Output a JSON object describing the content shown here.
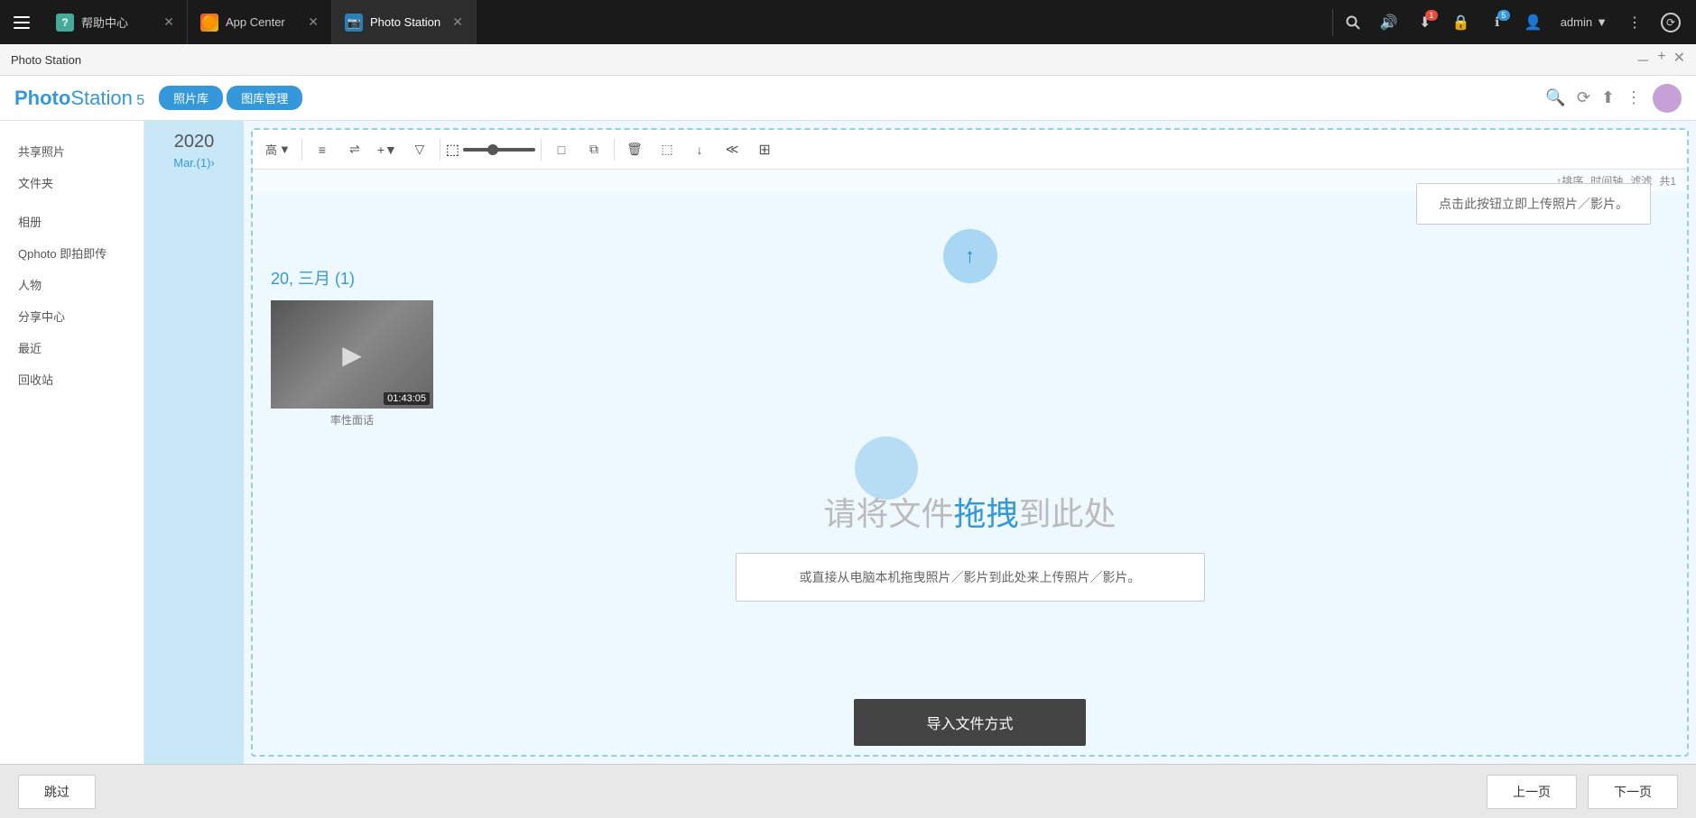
{
  "taskbar": {
    "tabs": [
      {
        "id": "help",
        "label": "帮助中心",
        "icon_type": "help",
        "icon_text": "?",
        "active": false
      },
      {
        "id": "appcenter",
        "label": "App Center",
        "icon_type": "appcenter",
        "icon_text": "✦",
        "active": false
      },
      {
        "id": "photostation",
        "label": "Photo Station",
        "icon_type": "photostation",
        "icon_text": "📷",
        "active": true
      }
    ],
    "notifications": {
      "download_badge": "1",
      "info_badge": "5"
    },
    "user": "admin",
    "dropdown_arrow": "▼"
  },
  "window": {
    "title": "Photo Station",
    "controls": {
      "minimize": "－",
      "maximize": "+",
      "close": "✕"
    }
  },
  "app_header": {
    "logo_photo": "Photo",
    "logo_station": "Station",
    "logo_version": " 5",
    "nav_photos": "照片库",
    "nav_library": "图库管理"
  },
  "sidebar": {
    "items": [
      {
        "label": "共享照片"
      },
      {
        "label": "文件夹"
      },
      {
        "label": "相册"
      },
      {
        "label": "Qphoto 即拍即传"
      },
      {
        "label": "人物"
      },
      {
        "label": "分享中心"
      },
      {
        "label": "最近"
      },
      {
        "label": "回收站"
      }
    ]
  },
  "timeline": {
    "year": "2020",
    "month": "Mar.(1)",
    "chevron": "›"
  },
  "toolbar": {
    "quality_label": "高",
    "quality_arrow": "▼",
    "upload_arrow": "↑",
    "icons": [
      "≡",
      "⇌",
      "+",
      "▼",
      "⬚",
      "▬▬",
      "□",
      "⧉",
      "🗑",
      "⬚",
      "↑",
      "↓",
      "≪",
      "⊞"
    ]
  },
  "sort_bar": {
    "sort_label": "↕排序",
    "timeline_label": "时间轴",
    "filter_label": "滤滤",
    "count_label": "共1"
  },
  "content": {
    "section_date": "20, 三月 (1)",
    "video_duration": "01:43:05",
    "video_label": "率性面话",
    "upload_hint": "点击此按钮立即上传照片／影片。",
    "drop_text_part1": "请将文件",
    "drop_text_highlight": "拖拽",
    "drop_text_part2": "到此处",
    "drag_box_text": "或直接从电脑本机拖曳照片／影片到此处来上传照片／影片。"
  },
  "import": {
    "button_label": "导入文件方式"
  },
  "bottom_nav": {
    "skip_label": "跳过",
    "prev_label": "上一页",
    "next_label": "下一页"
  }
}
